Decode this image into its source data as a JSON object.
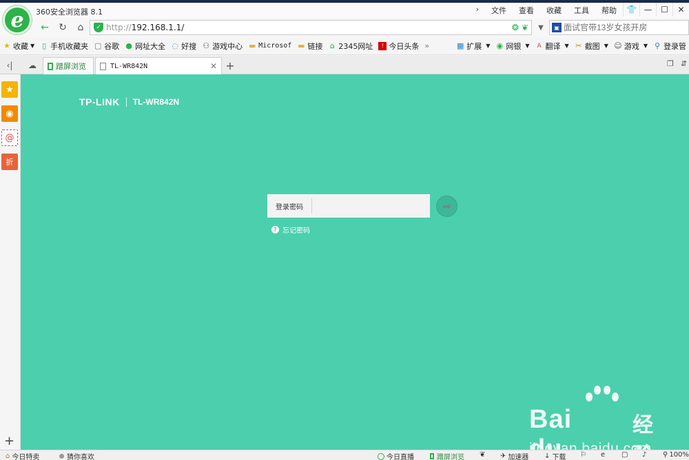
{
  "window": {
    "app_title": "360安全浏览器 8.1",
    "menu": [
      "文件",
      "查看",
      "收藏",
      "工具",
      "帮助"
    ]
  },
  "nav": {
    "url_protocol": "http://",
    "url_host": "192.168.1.1/",
    "search_placeholder": "面试官带13岁女孩开房"
  },
  "bookmarks": {
    "left": [
      "收藏",
      "手机收藏夹",
      "谷歌",
      "网址大全",
      "好搜",
      "游戏中心",
      "Microsof",
      "链接",
      "2345网址",
      "今日头条"
    ],
    "right": [
      "扩展",
      "网银",
      "翻译",
      "截图",
      "游戏",
      "登录管"
    ]
  },
  "tabs": {
    "items": [
      {
        "label": "蹭屏浏览"
      },
      {
        "label": "TL-WR842N"
      }
    ]
  },
  "router": {
    "brand": "TP-LINK",
    "model": "TL-WR842N",
    "password_label": "登录密码",
    "password_value": "",
    "forgot_label": "忘记密码"
  },
  "watermark": {
    "brand": "Bai du",
    "cn": "经验",
    "url": "jingyan.baidu.com"
  },
  "status": {
    "left": [
      "今日特卖",
      "猜你喜欢"
    ],
    "right": [
      "今日直播",
      "蹭屏浏览",
      "加速器",
      "下载",
      "100%"
    ]
  },
  "colors": {
    "page_bg": "#4ccfad",
    "accent_green": "#2bb24c"
  }
}
